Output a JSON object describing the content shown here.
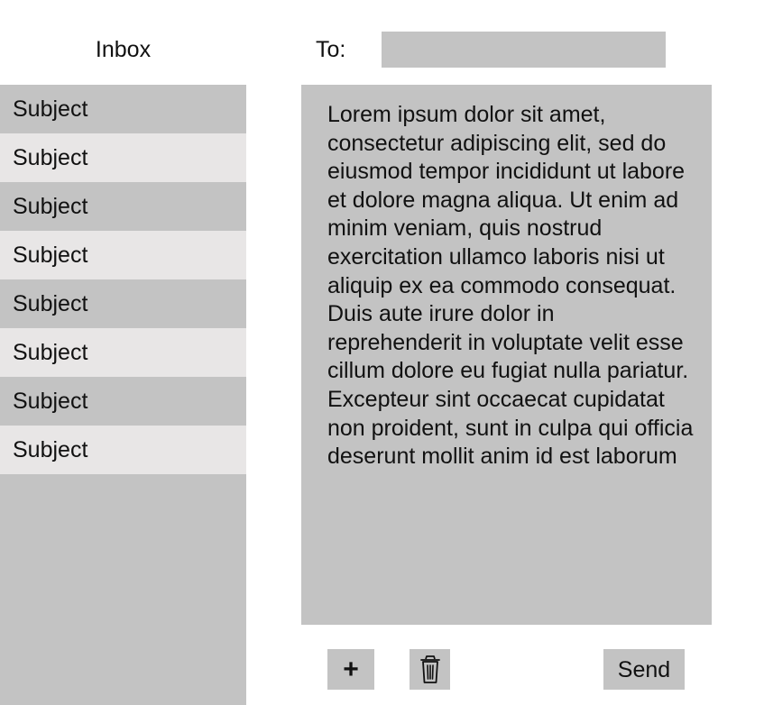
{
  "inbox": {
    "title": "Inbox",
    "items": [
      {
        "subject": "Subject"
      },
      {
        "subject": "Subject"
      },
      {
        "subject": "Subject"
      },
      {
        "subject": "Subject"
      },
      {
        "subject": "Subject"
      },
      {
        "subject": "Subject"
      },
      {
        "subject": "Subject"
      },
      {
        "subject": "Subject"
      }
    ]
  },
  "compose": {
    "to_label": "To:",
    "to_value": "",
    "body": "Lorem ipsum dolor sit amet, consectetur adipiscing elit, sed do eiusmod tempor incididunt ut labore et dolore magna aliqua. Ut enim ad minim veniam, quis nostrud exercitation ullamco laboris nisi ut aliquip ex ea commodo consequat. Duis aute irure dolor in reprehenderit in voluptate velit esse cillum dolore eu fugiat nulla pariatur. Excepteur sint occaecat cupidatat non proident, sunt in culpa qui officia deserunt mollit anim id est laborum"
  },
  "actions": {
    "add_label": "+",
    "delete_icon": "trash-icon",
    "send_label": "Send"
  },
  "colors": {
    "panel_gray": "#c3c3c3",
    "row_light": "#e8e6e6",
    "background": "#ffffff",
    "text": "#111111"
  }
}
